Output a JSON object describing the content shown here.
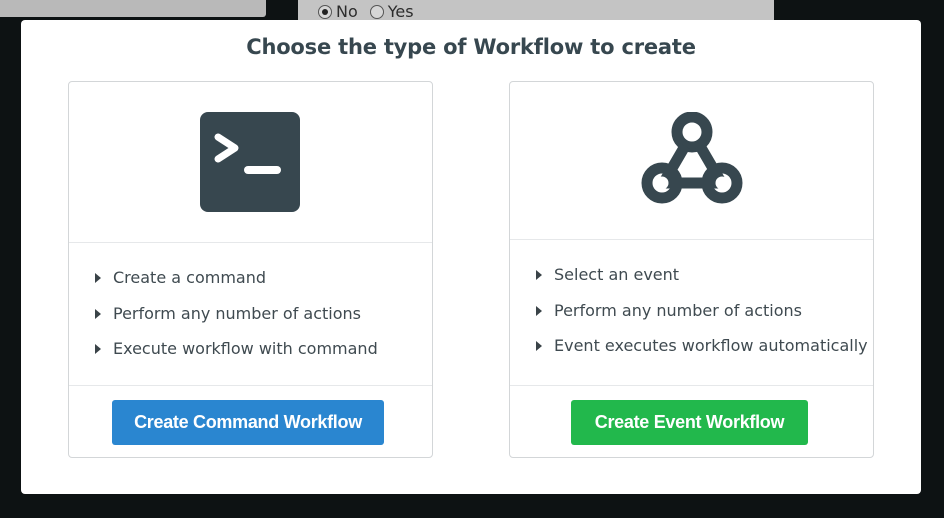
{
  "background": {
    "radio_options": [
      {
        "label": "No",
        "selected": true
      },
      {
        "label": "Yes",
        "selected": false
      }
    ]
  },
  "modal": {
    "title": "Choose the type of Workflow to create",
    "cards": [
      {
        "icon": "terminal-icon",
        "items": [
          "Create a command",
          "Perform any number of actions",
          "Execute workflow with command"
        ],
        "button_label": "Create Command Workflow",
        "button_color": "#2a86d0"
      },
      {
        "icon": "webhook-icon",
        "items": [
          "Select an event",
          "Perform any number of actions",
          "Event executes workflow automatically"
        ],
        "button_label": "Create Event Workflow",
        "button_color": "#22b84c"
      }
    ]
  }
}
